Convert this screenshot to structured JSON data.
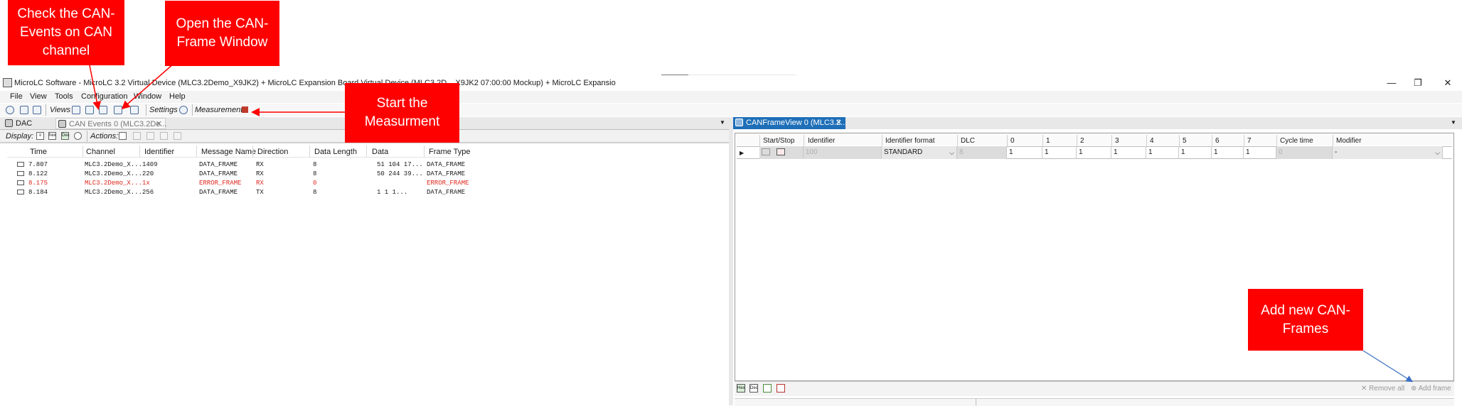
{
  "window": {
    "title": "MicroLC Software - MicroLC 3.2 Virtual Device (MLC3.2Demo_X9JK2) + MicroLC Expansion Board Virtual Device (MLC3.2D... X9JK2 07:00:00 Mockup) + MicroLC Expansio",
    "controls": [
      "✕",
      "❐",
      "—"
    ]
  },
  "menu": [
    "File",
    "View",
    "Tools",
    "Configuration",
    "Window",
    "Help"
  ],
  "toolbar": {
    "views_label": "Views",
    "settings_label": "Settings",
    "measurement_label": "Measurement"
  },
  "left_pane": {
    "tabs": [
      "DAC",
      "CAN Events 0 (MLC3.2De..."
    ],
    "display_label": "Display:",
    "actions_label": "Actions:",
    "columns": [
      "Time",
      "Channel",
      "Identifier",
      "Message Name",
      "Direction",
      "Data Length",
      "Data",
      "Frame Type"
    ],
    "rows": [
      {
        "time": "7.807",
        "channel": "MLC3.2Demo_X...",
        "identifier": "1409",
        "name": "DATA_FRAME",
        "direction": "RX",
        "length": "8",
        "data": "51 104  17...",
        "frame_type": "DATA_FRAME",
        "error": false
      },
      {
        "time": "8.122",
        "channel": "MLC3.2Demo_X...",
        "identifier": "220",
        "name": "DATA_FRAME",
        "direction": "RX",
        "length": "8",
        "data": "50 244  39...",
        "frame_type": "DATA_FRAME",
        "error": false
      },
      {
        "time": "8.175",
        "channel": "MLC3.2Demo_X...",
        "identifier": "1x",
        "name": "ERROR_FRAME",
        "direction": "RX",
        "length": "0",
        "data": "",
        "frame_type": "ERROR_FRAME",
        "error": true
      },
      {
        "time": "8.184",
        "channel": "MLC3.2Demo_X...",
        "identifier": "256",
        "name": "DATA_FRAME",
        "direction": "TX",
        "length": "8",
        "data": "1   1   1...",
        "frame_type": "DATA_FRAME",
        "error": false
      }
    ]
  },
  "right_pane": {
    "tab": "CANFrameView 0 (MLC3.2...",
    "columns": [
      "Start/Stop",
      "Identifier",
      "Identifier format",
      "DLC",
      "0",
      "1",
      "2",
      "3",
      "4",
      "5",
      "6",
      "7",
      "Cycle time",
      "Modifier"
    ],
    "row": {
      "identifier": "100",
      "format": "STANDARD",
      "dlc": "8",
      "bytes": [
        "1",
        "1",
        "1",
        "1",
        "1",
        "1",
        "1",
        "1"
      ],
      "cycle": "0",
      "modifier": "-"
    },
    "remove_all": "Remove all",
    "add_frame": "Add frame"
  },
  "annotations": [
    "Check the CAN-Events on CAN channel",
    "Open the CAN-Frame Window",
    "Start the Measurment",
    "Add new CAN-Frames"
  ],
  "colors": {
    "annotation": "#ff0000",
    "active_tab": "#1e6fb8",
    "error_text": "#e0281e"
  }
}
